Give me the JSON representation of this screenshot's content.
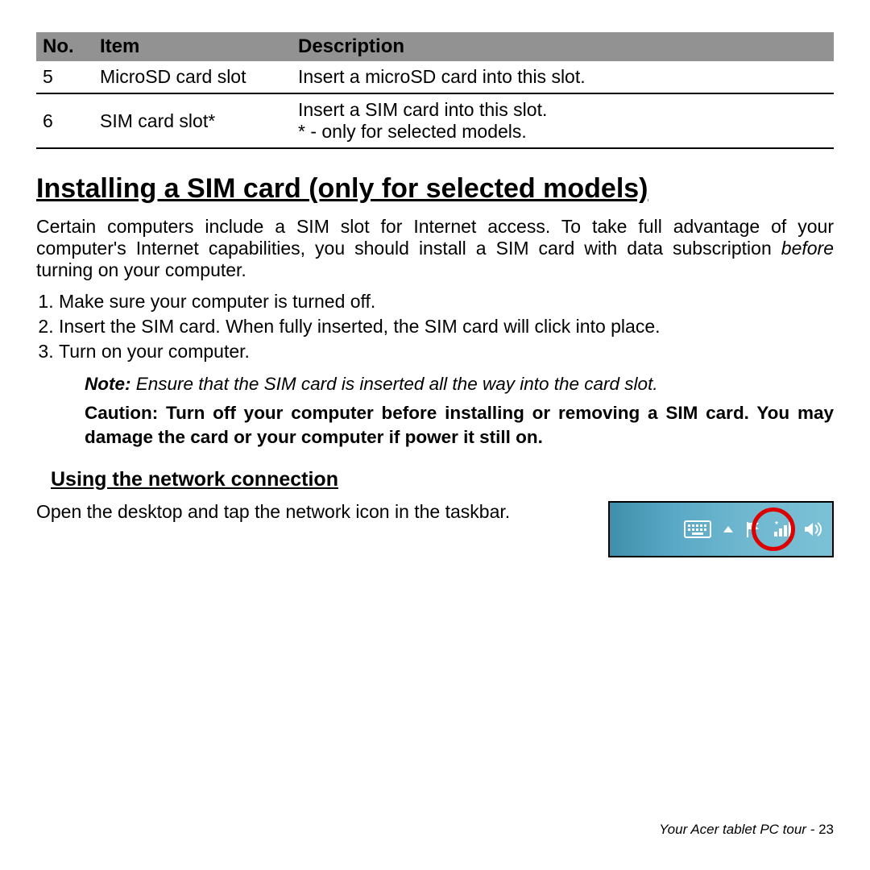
{
  "table": {
    "headers": {
      "no": "No.",
      "item": "Item",
      "desc": "Description"
    },
    "rows": [
      {
        "no": "5",
        "item": "MicroSD card slot",
        "desc": "Insert a microSD card into this slot."
      },
      {
        "no": "6",
        "item": "SIM card slot*",
        "desc": "Insert a SIM card into this slot.\n* - only for selected models."
      }
    ]
  },
  "h1": "Installing a SIM card (only for selected models)",
  "intro_pre": "Certain computers include a SIM slot for Internet access. To take full advantage of your computer's Internet capabilities, you should install a SIM card with data subscription ",
  "intro_em": "before",
  "intro_post": " turning on your computer.",
  "steps": [
    "Make sure your computer is turned off.",
    "Insert the SIM card. When fully inserted, the SIM card will click into place.",
    "Turn on your computer."
  ],
  "note_label": "Note:",
  "note_text": " Ensure that the SIM card is inserted all the way into the card slot.",
  "caution": "Caution: Turn off your computer before installing or removing a SIM card. You may damage the card or your computer if power it still on.",
  "h2": "Using the network connection",
  "net_text": "Open the desktop and tap the network icon in the taskbar.",
  "taskbar_icons": {
    "keyboard": "keyboard-icon",
    "arrow": "arrow-up-icon",
    "flag": "flag-icon",
    "network": "network-signal-icon",
    "volume": "volume-icon"
  },
  "footer_label": "Your Acer tablet PC tour -  ",
  "footer_page": "23"
}
